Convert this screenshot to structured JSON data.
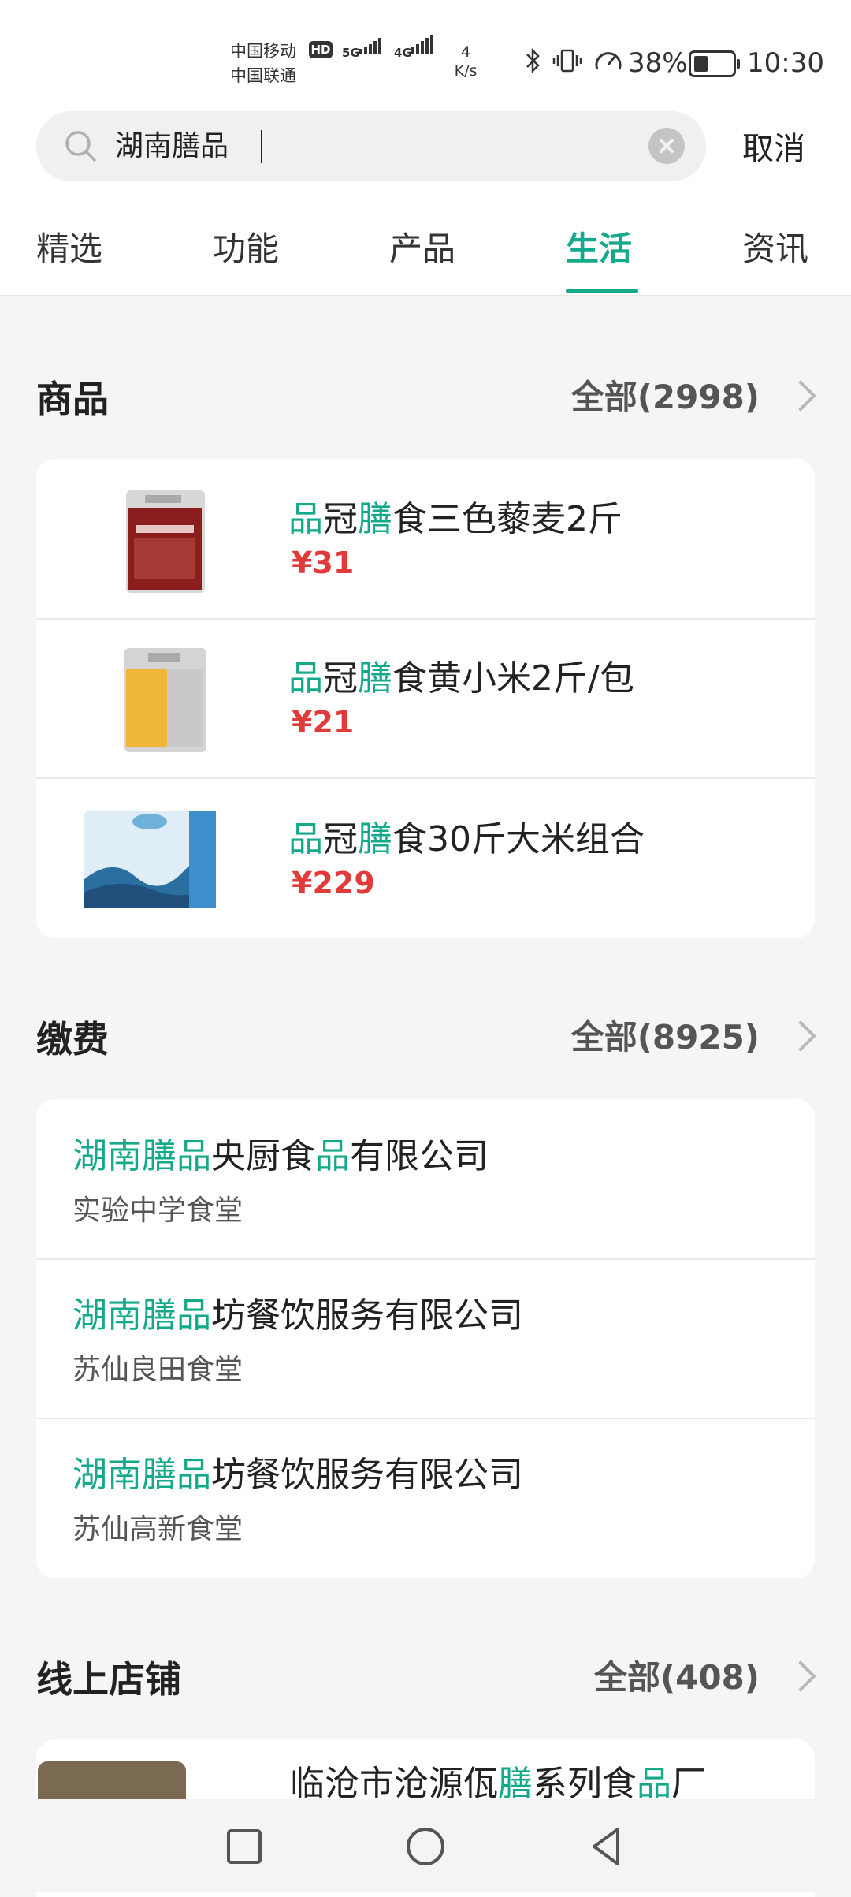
{
  "status_bar": {
    "carrier1": "中国移动",
    "carrier2": "中国联通",
    "hd": "HD",
    "net1": "5G",
    "net2": "4G",
    "speed_value": "4",
    "speed_unit": "K/s",
    "battery_pct": "38%",
    "battery_level": 0.38,
    "time": "10:30"
  },
  "search": {
    "value": "湖南膳品",
    "cancel_label": "取消"
  },
  "tabs": [
    {
      "label": "精选"
    },
    {
      "label": "功能"
    },
    {
      "label": "产品"
    },
    {
      "label": "生活"
    },
    {
      "label": "资讯"
    }
  ],
  "active_tab": "生活",
  "accent_color": "#13a98a",
  "price_color": "#e03a3a",
  "goods": {
    "title": "商品",
    "more": "全部(2998)",
    "items": [
      {
        "hl1": "品",
        "t1": "冠",
        "hl2": "膳",
        "t2": "食三色藜麦2斤",
        "price": "¥31"
      },
      {
        "hl1": "品",
        "t1": "冠",
        "hl2": "膳",
        "t2": "食黄小米2斤/包",
        "price": "¥21"
      },
      {
        "hl1": "品",
        "t1": "冠",
        "hl2": "膳",
        "t2": "食30斤大米组合",
        "price": "¥229"
      }
    ]
  },
  "bills": {
    "title": "缴费",
    "more": "全部(8925)",
    "items": [
      {
        "name_parts": [
          {
            "text": "湖南膳品",
            "hl": true
          },
          {
            "text": "央厨食",
            "hl": false
          },
          {
            "text": "品",
            "hl": true
          },
          {
            "text": "有限公司",
            "hl": false
          }
        ],
        "sub": "实验中学食堂"
      },
      {
        "name_parts": [
          {
            "text": "湖南膳品",
            "hl": true
          },
          {
            "text": "坊餐饮服务有限公司",
            "hl": false
          }
        ],
        "sub": "苏仙良田食堂"
      },
      {
        "name_parts": [
          {
            "text": "湖南膳品",
            "hl": true
          },
          {
            "text": "坊餐饮服务有限公司",
            "hl": false
          }
        ],
        "sub": "苏仙高新食堂"
      }
    ]
  },
  "stores": {
    "title": "线上店铺",
    "more": "全部(408)",
    "items": [
      {
        "name_parts": [
          {
            "text": "临沧市沧源佤",
            "hl": false
          },
          {
            "text": "膳",
            "hl": true
          },
          {
            "text": "系列食",
            "hl": false
          },
          {
            "text": "品",
            "hl": true
          },
          {
            "text": "厂",
            "hl": false
          }
        ]
      }
    ]
  },
  "nav": {
    "recent": "square-icon",
    "home": "circle-icon",
    "back": "triangle-back-icon"
  }
}
